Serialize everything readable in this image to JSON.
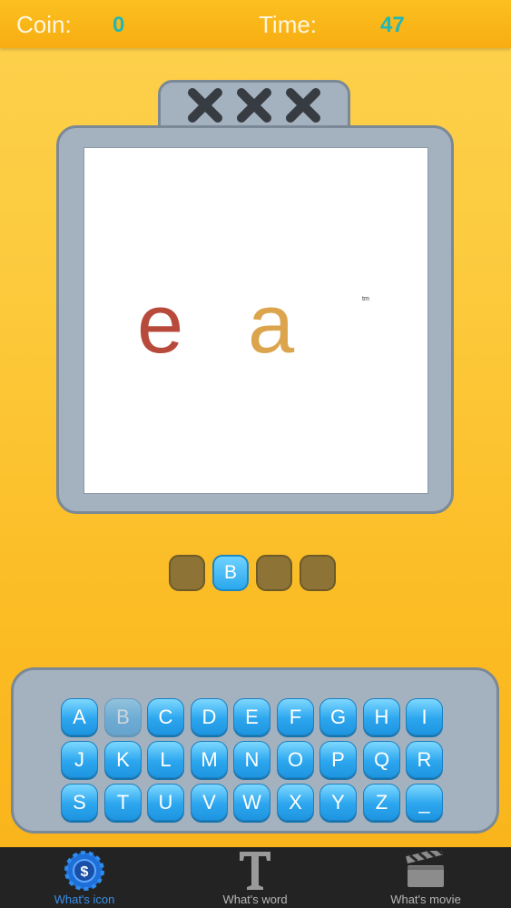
{
  "header": {
    "coin_label": "Coin:",
    "coin_value": "0",
    "time_label": "Time:",
    "time_value": "47"
  },
  "lives": {
    "icons": [
      "x-icon",
      "x-icon",
      "x-icon"
    ]
  },
  "puzzle": {
    "letters": [
      {
        "char": "e",
        "color": "#b84a3c"
      },
      {
        "char": "a",
        "color": "#dca54d"
      }
    ],
    "trademark": "tm"
  },
  "answer": {
    "slots": [
      "",
      "B",
      "",
      ""
    ]
  },
  "keyboard": {
    "rows": [
      [
        "A",
        "B",
        "C",
        "D",
        "E",
        "F",
        "G",
        "H",
        "I"
      ],
      [
        "J",
        "K",
        "L",
        "M",
        "N",
        "O",
        "P",
        "Q",
        "R"
      ],
      [
        "S",
        "T",
        "U",
        "V",
        "W",
        "X",
        "Y",
        "Z",
        "_"
      ]
    ],
    "used_key": "B"
  },
  "nav": {
    "items": [
      {
        "label": "What's icon",
        "icon": "coin-icon",
        "active": true
      },
      {
        "label": "What's word",
        "icon": "letter-t-icon",
        "active": false
      },
      {
        "label": "What's movie",
        "icon": "clapperboard-icon",
        "active": false
      }
    ]
  },
  "colors": {
    "accent": "#3a8fe8",
    "background": "#fcc93a",
    "key": "#2ca6ee",
    "frame": "#a4b1bf"
  }
}
